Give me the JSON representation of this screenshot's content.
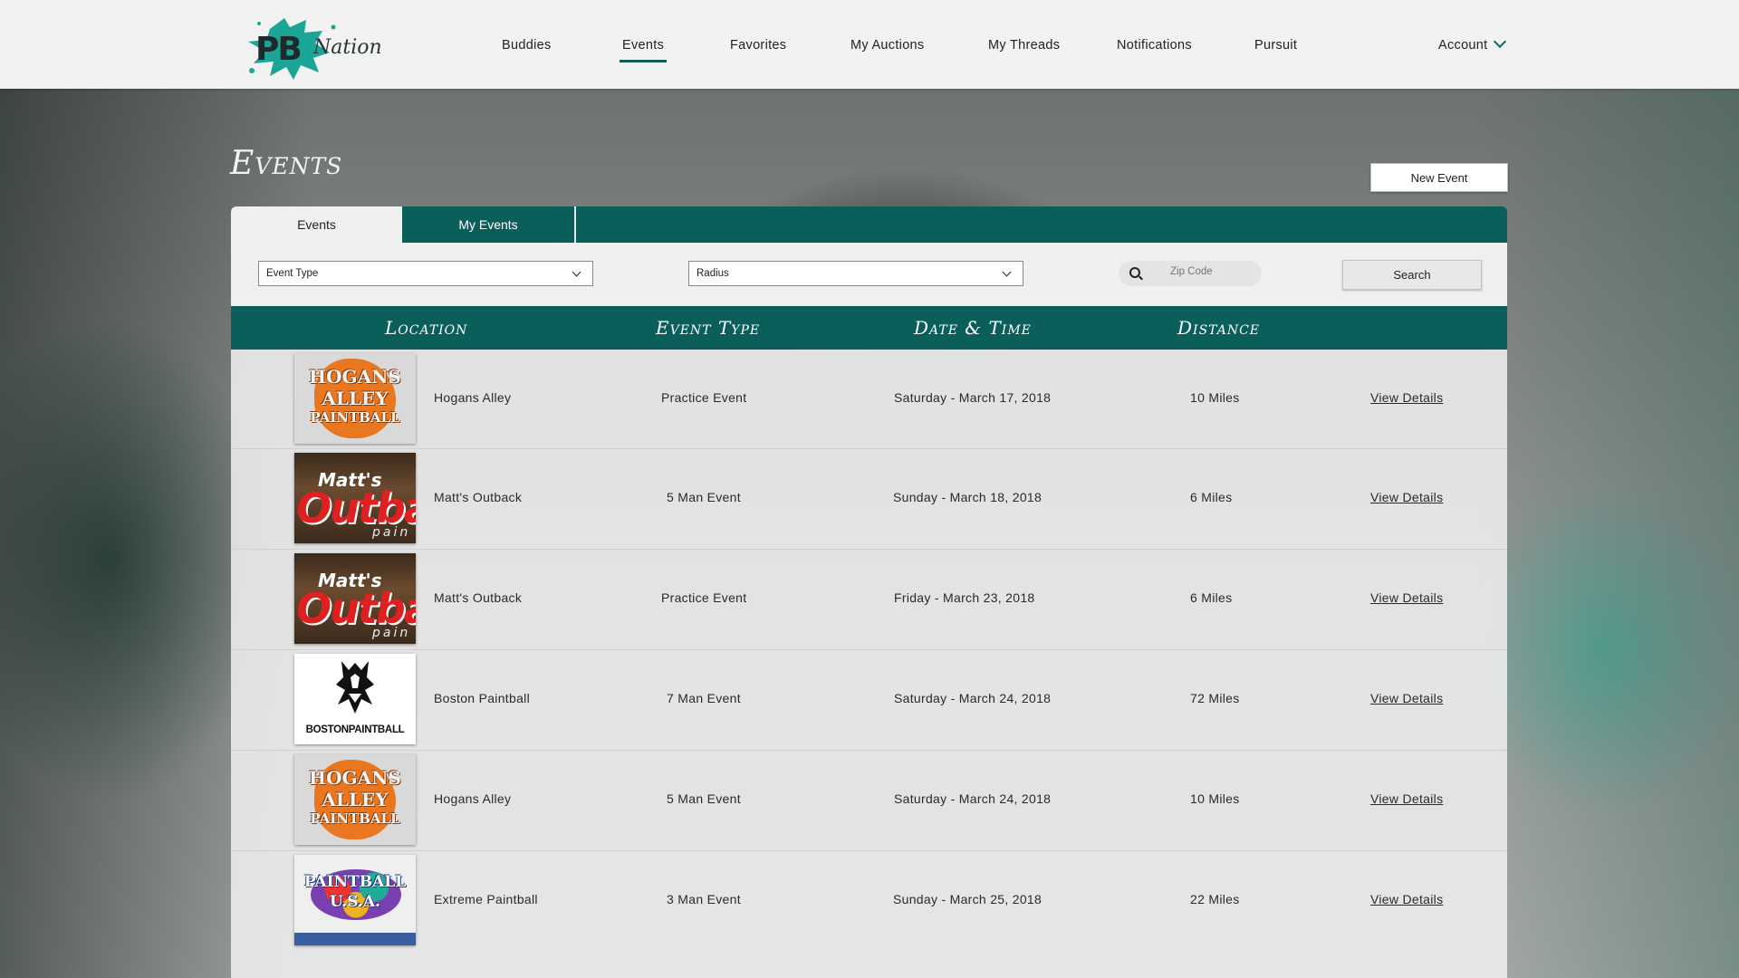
{
  "brand": {
    "logo_text_pb": "PB",
    "logo_text_nation": "Nation"
  },
  "nav": {
    "items": [
      "Buddies",
      "Events",
      "Favorites",
      "My Auctions",
      "My Threads",
      "Notifications",
      "Pursuit"
    ],
    "active": "Events",
    "account": "Account"
  },
  "page": {
    "title": "Events",
    "new_event_label": "New Event"
  },
  "tabs": {
    "events": "Events",
    "my_events": "My Events",
    "active": "Events"
  },
  "filters": {
    "event_type": "Event Type",
    "radius": "Radius",
    "zip_placeholder": "Zip Code",
    "search_label": "Search"
  },
  "table": {
    "headers": {
      "location": "Location",
      "event_type": "Event Type",
      "date_time": "Date & Time",
      "distance": "Distance"
    },
    "rows": [
      {
        "logo": "hogans-alley-logo",
        "location": "Hogans Alley",
        "type": "Practice Event",
        "date": "Saturday - March 17, 2018",
        "distance": "10 Miles",
        "action": "View Details"
      },
      {
        "logo": "matts-outback-logo",
        "location": "Matt's Outback",
        "type": "5 Man Event",
        "date": "Sunday - March 18, 2018",
        "distance": "6 Miles",
        "action": "View Details"
      },
      {
        "logo": "matts-outback-logo",
        "location": "Matt's Outback",
        "type": "Practice Event",
        "date": "Friday - March 23, 2018",
        "distance": "6 Miles",
        "action": "View Details"
      },
      {
        "logo": "boston-paintball-logo",
        "location": "Boston Paintball",
        "type": "7 Man Event",
        "date": "Saturday - March 24, 2018",
        "distance": "72 Miles",
        "action": "View Details"
      },
      {
        "logo": "hogans-alley-logo",
        "location": "Hogans Alley",
        "type": "5 Man Event",
        "date": "Saturday - March 24, 2018",
        "distance": "10 Miles",
        "action": "View Details"
      },
      {
        "logo": "paintball-usa-logo",
        "location": "Extreme Paintball",
        "type": "3 Man Event",
        "date": "Sunday - March 25, 2018",
        "distance": "22 Miles",
        "action": "View Details"
      }
    ]
  },
  "logos": {
    "hogans": [
      "HOGANS",
      "ALLEY",
      "PAINTBALL"
    ],
    "matts": [
      "Matt's",
      "Outba",
      "pain"
    ],
    "boston": "BOSTONPAINTBALL",
    "usa": [
      "PAINTBALL",
      "U.S.A."
    ]
  },
  "colors": {
    "brand_teal": "#0b5f5b",
    "header_bg": "#f2f2f2",
    "row_bg": "#e8e8e8"
  }
}
